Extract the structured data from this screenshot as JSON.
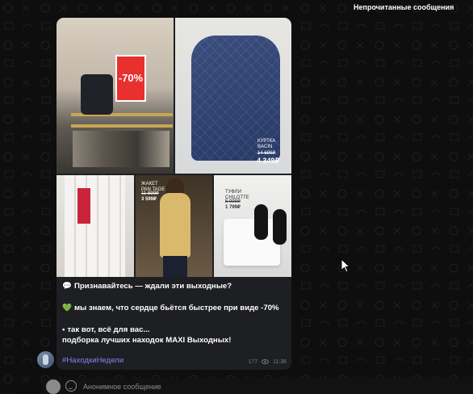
{
  "banner": {
    "unread_label": "Непрочитанные сообщения"
  },
  "post": {
    "photos": [
      {
        "id": "sale-rack",
        "sign": "-70%"
      },
      {
        "id": "quilted-jacket",
        "tag_name": "КУРТКА\nBACIN",
        "tag_old": "14 699₽",
        "tag_new": "4 349₽"
      },
      {
        "id": "white-trousers"
      },
      {
        "id": "blazer-mirror",
        "tag_name": "ЖАКЕТ\nPAN TAGE",
        "tag_old": "11 899₽",
        "tag_new": "3 599₽"
      },
      {
        "id": "black-flats",
        "tag_name": "ТУФЛИ\nCHILOTTE",
        "tag_old": "5 999₽",
        "tag_new": "1 799₽"
      }
    ],
    "lines": [
      {
        "emoji": "💬",
        "text": "Признавайтесь — ждали эти выходные?"
      },
      {
        "emoji": "💚",
        "text": "мы знаем, что сердце бьётся быстрее при виде -70%"
      },
      {
        "emoji": "•",
        "text": "так вот, всё для вас..."
      },
      {
        "emoji": "",
        "text": "подборка лучших находок MAXI Выходных!"
      }
    ],
    "hashtag": "#НаходкиНедели",
    "views": "177",
    "time": "11:36"
  },
  "composer": {
    "placeholder": "Анонимное сообщение"
  },
  "colors": {
    "background": "#0e0e0e",
    "bubble": "#1e1f23",
    "hashtag": "#8e7cf5",
    "accent_sale": "#e8302f"
  }
}
